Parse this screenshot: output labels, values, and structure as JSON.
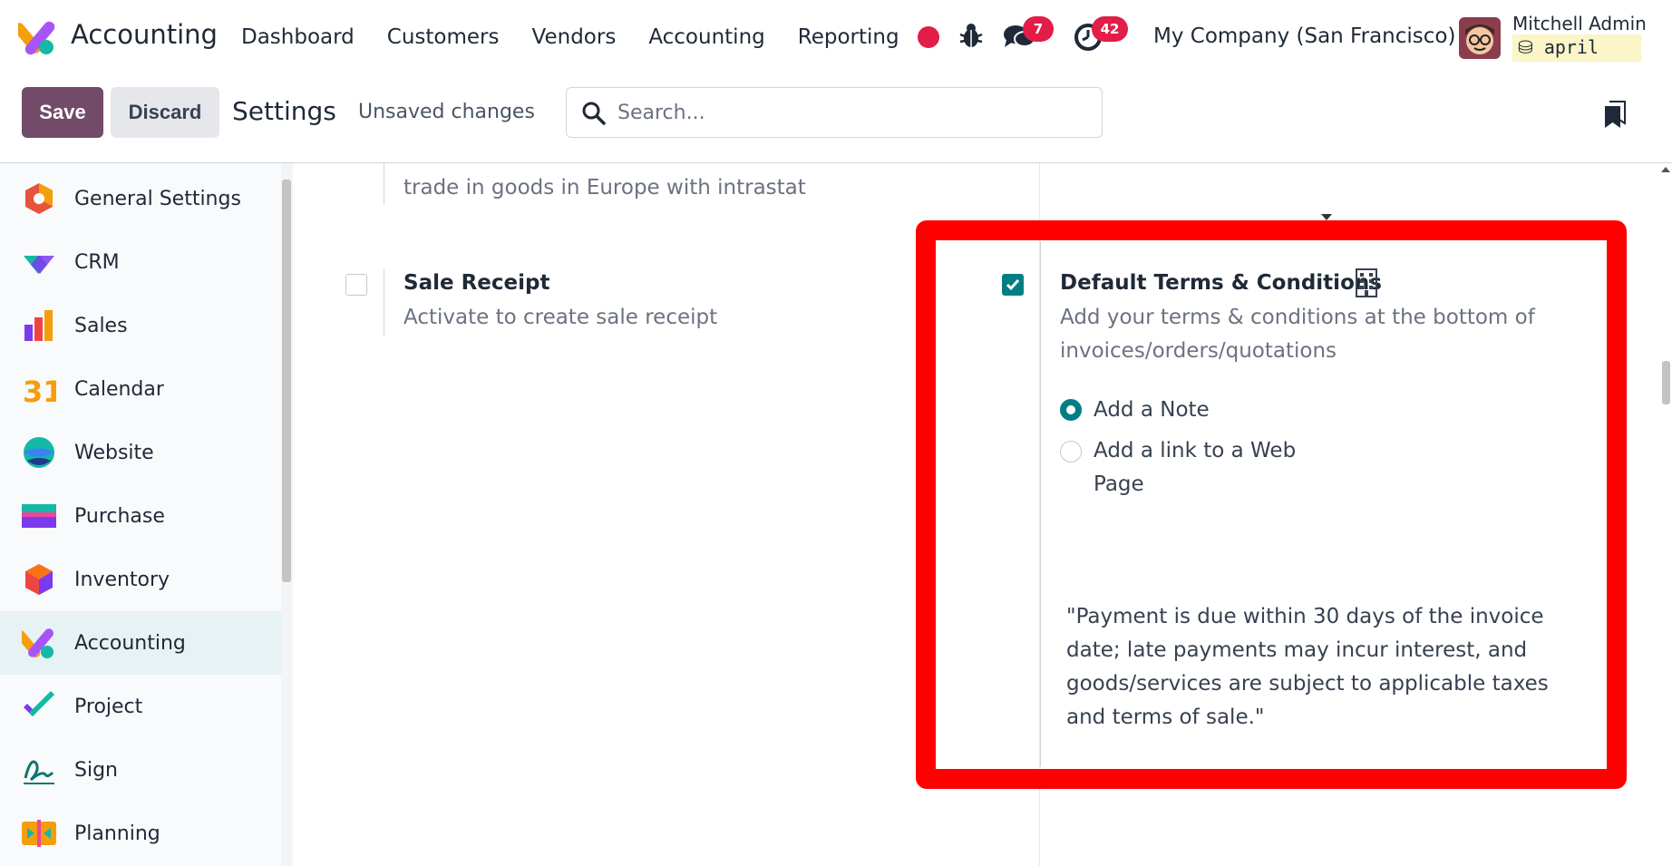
{
  "navbar": {
    "app_name": "Accounting",
    "menu": [
      "Dashboard",
      "Customers",
      "Vendors",
      "Accounting",
      "Reporting"
    ],
    "chat_count": "7",
    "activity_count": "42",
    "company": "My Company (San Francisco)",
    "user_name": "Mitchell Admin",
    "database": "april"
  },
  "control_panel": {
    "save_label": "Save",
    "discard_label": "Discard",
    "title": "Settings",
    "unsaved": "Unsaved changes",
    "search_placeholder": "Search..."
  },
  "sidebar": {
    "items": [
      {
        "label": "General Settings",
        "icon": "general-settings-icon"
      },
      {
        "label": "CRM",
        "icon": "crm-icon"
      },
      {
        "label": "Sales",
        "icon": "sales-icon"
      },
      {
        "label": "Calendar",
        "icon": "calendar-icon",
        "icon_text": "31"
      },
      {
        "label": "Website",
        "icon": "website-icon"
      },
      {
        "label": "Purchase",
        "icon": "purchase-icon"
      },
      {
        "label": "Inventory",
        "icon": "inventory-icon"
      },
      {
        "label": "Accounting",
        "icon": "accounting-icon",
        "active": true
      },
      {
        "label": "Project",
        "icon": "project-icon"
      },
      {
        "label": "Sign",
        "icon": "sign-icon"
      },
      {
        "label": "Planning",
        "icon": "planning-icon"
      }
    ]
  },
  "settings": {
    "intrastat_desc_tail": "trade in goods in Europe with intrastat",
    "sale_receipt": {
      "title": "Sale Receipt",
      "desc": "Activate to create sale receipt",
      "checked": false
    },
    "default_terms": {
      "title": "Default Terms & Conditions",
      "desc": "Add your terms & conditions at the bottom of invoices/orders/quotations",
      "checked": true,
      "options": [
        {
          "label": "Add a Note",
          "selected": true
        },
        {
          "label": "Add a link to a Web Page",
          "selected": false
        }
      ],
      "note_text": "\"Payment is due within 30 days of the invoice date; late payments may incur interest, and goods/services are subject to applicable taxes and terms of sale.\""
    }
  },
  "colors": {
    "brand": "#714b67",
    "accent": "#017e84",
    "badge": "#e11d48",
    "highlight": "#ff0000",
    "sidebar_active": "#e6f2f3"
  }
}
